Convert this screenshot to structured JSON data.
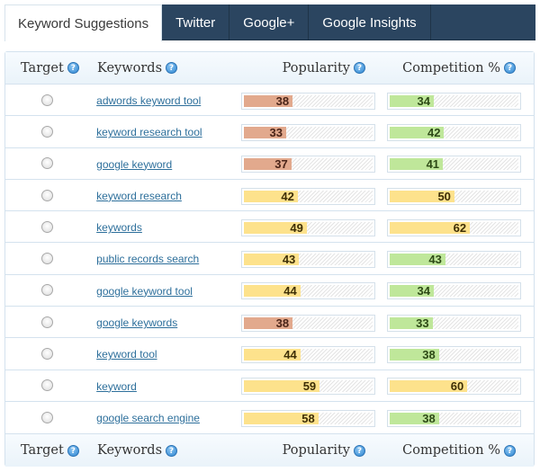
{
  "tabs": [
    {
      "label": "Keyword Suggestions",
      "active": true
    },
    {
      "label": "Twitter",
      "active": false
    },
    {
      "label": "Google+",
      "active": false
    },
    {
      "label": "Google Insights",
      "active": false
    }
  ],
  "columns": {
    "target": "Target",
    "keywords": "Keywords",
    "popularity": "Popularity",
    "competition": "Competition %",
    "help_glyph": "?"
  },
  "scale_max": 100,
  "colors": {
    "low": "#e2a98d",
    "mid": "#fde28c",
    "good": "#bfe79a"
  },
  "rows": [
    {
      "keyword": "adwords keyword tool",
      "popularity": 38,
      "popularity_color": "red",
      "competition": 34,
      "competition_color": "green"
    },
    {
      "keyword": "keyword research tool",
      "popularity": 33,
      "popularity_color": "red",
      "competition": 42,
      "competition_color": "green"
    },
    {
      "keyword": "google keyword",
      "popularity": 37,
      "popularity_color": "red",
      "competition": 41,
      "competition_color": "green"
    },
    {
      "keyword": "keyword research",
      "popularity": 42,
      "popularity_color": "yellow",
      "competition": 50,
      "competition_color": "yellow"
    },
    {
      "keyword": "keywords",
      "popularity": 49,
      "popularity_color": "yellow",
      "competition": 62,
      "competition_color": "yellow"
    },
    {
      "keyword": "public records search",
      "popularity": 43,
      "popularity_color": "yellow",
      "competition": 43,
      "competition_color": "green"
    },
    {
      "keyword": "google keyword tool",
      "popularity": 44,
      "popularity_color": "yellow",
      "competition": 34,
      "competition_color": "green"
    },
    {
      "keyword": "google keywords",
      "popularity": 38,
      "popularity_color": "red",
      "competition": 33,
      "competition_color": "green"
    },
    {
      "keyword": "keyword tool",
      "popularity": 44,
      "popularity_color": "yellow",
      "competition": 38,
      "competition_color": "green"
    },
    {
      "keyword": "keyword",
      "popularity": 59,
      "popularity_color": "yellow",
      "competition": 60,
      "competition_color": "yellow"
    },
    {
      "keyword": "google search engine",
      "popularity": 58,
      "popularity_color": "yellow",
      "competition": 38,
      "competition_color": "green"
    }
  ]
}
